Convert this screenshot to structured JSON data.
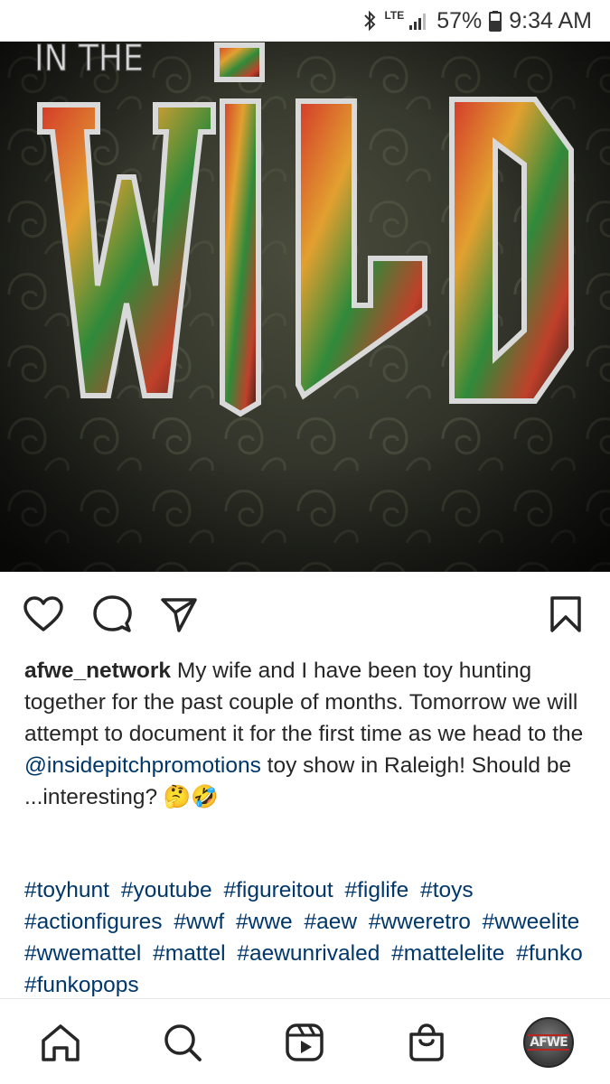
{
  "status_bar": {
    "network": "LTE",
    "battery_percent": "57%",
    "time": "9:34 AM",
    "icons": [
      "bluetooth-icon",
      "signal-icon",
      "battery-icon"
    ]
  },
  "post_image": {
    "top_text": "IN THE",
    "main_text": "WILD"
  },
  "caption": {
    "username": "afwe_network",
    "text_1": "My wife and I have been toy hunting together for the past couple of months. Tomorrow we will attempt to document it for the first time as we head to the",
    "mention": "@insidepitchpromotions",
    "text_2": "toy show in Raleigh! Should be",
    "text_3": "...interesting?",
    "emoji": "🤔🤣"
  },
  "hashtags": [
    "#toyhunt",
    "#youtube",
    "#figureitout",
    "#figlife",
    "#toys",
    "#actionfigures",
    "#wwf",
    "#wwe",
    "#aew",
    "#wweretro",
    "#wweelite",
    "#wwemattel",
    "#mattel",
    "#aewunrivaled",
    "#mattelelite",
    "#funko",
    "#funkopops"
  ],
  "bottom_nav": {
    "avatar_text": "AFWE"
  },
  "colors": {
    "link": "#00376b",
    "text": "#262626"
  }
}
